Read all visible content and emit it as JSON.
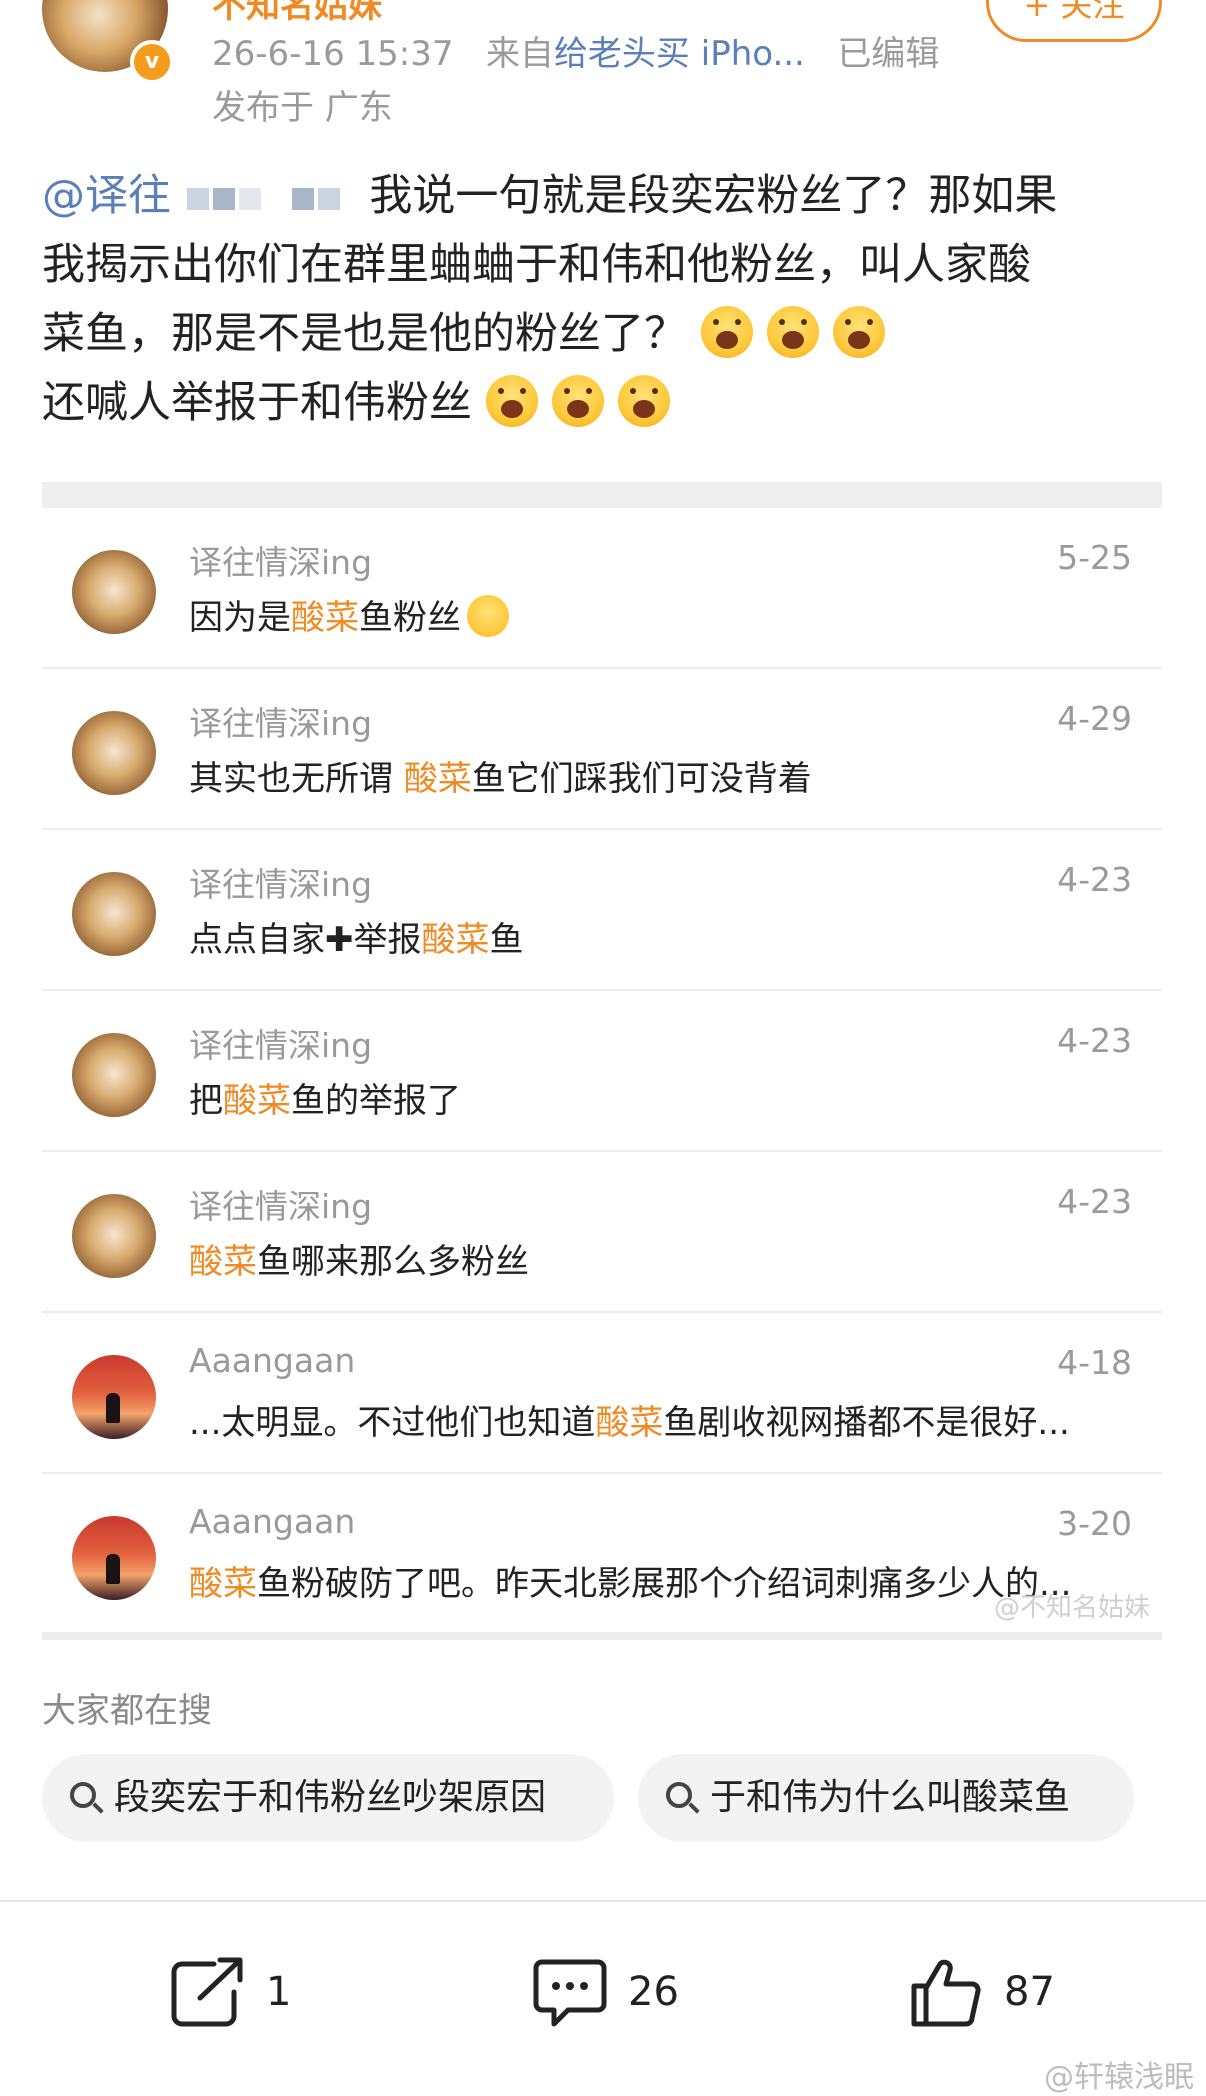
{
  "header": {
    "username": "不知名姑妹",
    "timestamp": "26-6-16 15:37",
    "source_prefix": "来自",
    "source_device": "给老头买 iPho...",
    "edited": "已编辑",
    "location": "发布于 广东",
    "follow_label": "+ 关注",
    "verified_badge": "v"
  },
  "post": {
    "mention": "@译往",
    "line1": "我说一句就是段奕宏粉丝了？那如果",
    "line2": "我揭示出你们在群里蛐蛐于和伟和他粉丝，叫人家酸",
    "line3": "菜鱼，那是不是也是他的粉丝了？",
    "line4": "还喊人举报于和伟粉丝",
    "emoji_icon": "astonished-emoji-icon"
  },
  "comments": [
    {
      "name": "译往情深ing",
      "date": "5-25",
      "pre": "因为是",
      "hl": "酸菜",
      "post": "鱼粉丝",
      "avatar": "cat"
    },
    {
      "name": "译往情深ing",
      "date": "4-29",
      "pre": "其实也无所谓 ",
      "hl": "酸菜",
      "post": "鱼它们踩我们可没背着",
      "avatar": "cat"
    },
    {
      "name": "译往情深ing",
      "date": "4-23",
      "pre": "点点自家",
      "plus": "✚",
      "mid": "举报",
      "hl": "酸菜",
      "post": "鱼",
      "avatar": "cat"
    },
    {
      "name": "译往情深ing",
      "date": "4-23",
      "pre": "把",
      "hl": "酸菜",
      "post": "鱼的举报了",
      "avatar": "cat"
    },
    {
      "name": "译往情深ing",
      "date": "4-23",
      "pre": "",
      "hl": "酸菜",
      "post": "鱼哪来那么多粉丝",
      "avatar": "cat"
    },
    {
      "name": "Aaangaan",
      "date": "4-18",
      "pre": "...太明显。不过他们也知道",
      "hl": "酸菜",
      "post": "鱼剧收视网播都不是很好...",
      "avatar": "sunset"
    },
    {
      "name": "Aaangaan",
      "date": "3-20",
      "pre": "",
      "hl": "酸菜",
      "post": "鱼粉破防了吧。昨天北影展那个介绍词刺痛多少人的...",
      "avatar": "sunset"
    }
  ],
  "watermark_inner": "@不知名姑妹",
  "search": {
    "title": "大家都在搜",
    "chips": [
      "段奕宏于和伟粉丝吵架原因",
      "于和伟为什么叫酸菜鱼"
    ]
  },
  "actions": {
    "repost_count": "1",
    "comment_count": "26",
    "like_count": "87"
  },
  "watermark_outer": "@轩辕浅眠",
  "colors": {
    "accent": "#f08a24",
    "link": "#5b7fb8",
    "muted": "#9a9a9a"
  }
}
